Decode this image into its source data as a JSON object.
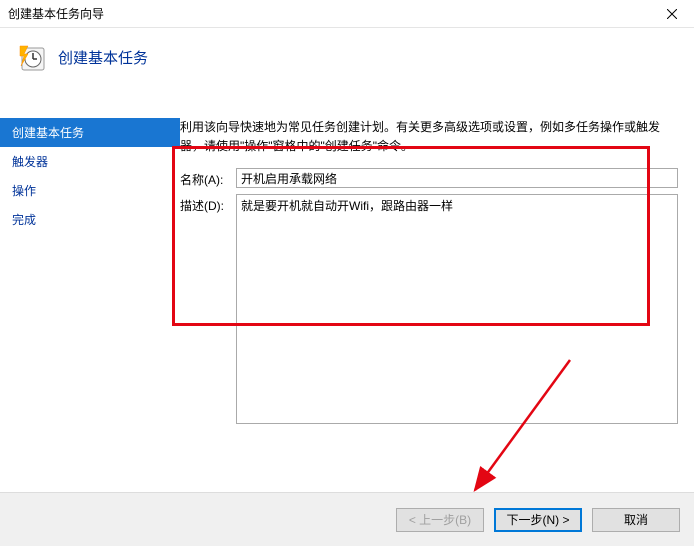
{
  "window": {
    "title": "创建基本任务向导"
  },
  "header": {
    "title": "创建基本任务"
  },
  "sidebar": {
    "items": [
      {
        "label": "创建基本任务"
      },
      {
        "label": "触发器"
      },
      {
        "label": "操作"
      },
      {
        "label": "完成"
      }
    ]
  },
  "content": {
    "instruction": "利用该向导快速地为常见任务创建计划。有关更多高级选项或设置，例如多任务操作或触发器，请使用\"操作\"窗格中的\"创建任务\"命令。",
    "name_label": "名称(A):",
    "name_value": "开机启用承载网络",
    "desc_label": "描述(D):",
    "desc_value": "就是要开机就自动开Wifi，跟路由器一样"
  },
  "footer": {
    "back": "< 上一步(B)",
    "next": "下一步(N) >",
    "cancel": "取消"
  }
}
